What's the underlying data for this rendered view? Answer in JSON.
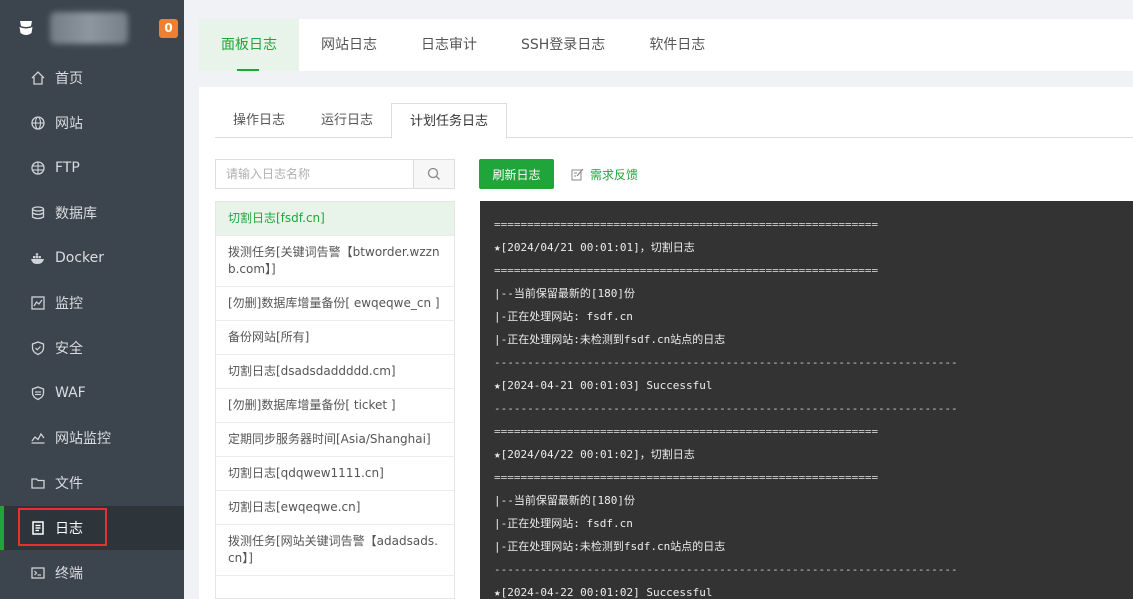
{
  "sidebar": {
    "badge": "0",
    "items": [
      {
        "label": "首页",
        "icon": "home-icon"
      },
      {
        "label": "网站",
        "icon": "globe-icon"
      },
      {
        "label": "FTP",
        "icon": "ftp-globe-icon"
      },
      {
        "label": "数据库",
        "icon": "database-icon"
      },
      {
        "label": "Docker",
        "icon": "docker-icon"
      },
      {
        "label": "监控",
        "icon": "monitor-icon"
      },
      {
        "label": "安全",
        "icon": "shield-icon"
      },
      {
        "label": "WAF",
        "icon": "waf-shield-icon"
      },
      {
        "label": "网站监控",
        "icon": "site-monitor-icon"
      },
      {
        "label": "文件",
        "icon": "folder-icon"
      },
      {
        "label": "日志",
        "icon": "log-icon"
      },
      {
        "label": "终端",
        "icon": "terminal-icon"
      }
    ],
    "active_index": 10
  },
  "top_tabs": [
    "面板日志",
    "网站日志",
    "日志审计",
    "SSH登录日志",
    "软件日志"
  ],
  "sub_tabs": [
    "操作日志",
    "运行日志",
    "计划任务日志"
  ],
  "search": {
    "placeholder": "请输入日志名称",
    "value": ""
  },
  "task_list": [
    "切割日志[fsdf.cn]",
    "拨测任务[关键词告警【btworder.wzznb.com】]",
    "[勿删]数据库增量备份[ ewqeqwe_cn ]",
    "备份网站[所有]",
    "切割日志[dsadsdaddddd.cm]",
    "[勿删]数据库增量备份[ ticket ]",
    "定期同步服务器时间[Asia/Shanghai]",
    "切割日志[qdqwew1111.cn]",
    "切割日志[ewqeqwe.cn]",
    "拨测任务[网站关键词告警【adadsads.cn】]"
  ],
  "buttons": {
    "refresh": "刷新日志",
    "feedback": "需求反馈"
  },
  "log_lines": [
    "==========================================================",
    "★[2024/04/21 00:01:01]，切割日志",
    "==========================================================",
    "|--当前保留最新的[180]份",
    "|-正在处理网站: fsdf.cn",
    "|-正在处理网站:未检测到fsdf.cn站点的日志",
    "----------------------------------------------------------------------",
    "★[2024-04-21 00:01:03] Successful",
    "----------------------------------------------------------------------",
    "==========================================================",
    "★[2024/04/22 00:01:02]，切割日志",
    "==========================================================",
    "|--当前保留最新的[180]份",
    "|-正在处理网站: fsdf.cn",
    "|-正在处理网站:未检测到fsdf.cn站点的日志",
    "----------------------------------------------------------------------",
    "★[2024-04-22 00:01:02] Successful"
  ],
  "colors": {
    "accent": "#20a53a",
    "sidebar_bg": "#3c444d",
    "badge": "#f0802f",
    "highlight": "#e5322d"
  }
}
